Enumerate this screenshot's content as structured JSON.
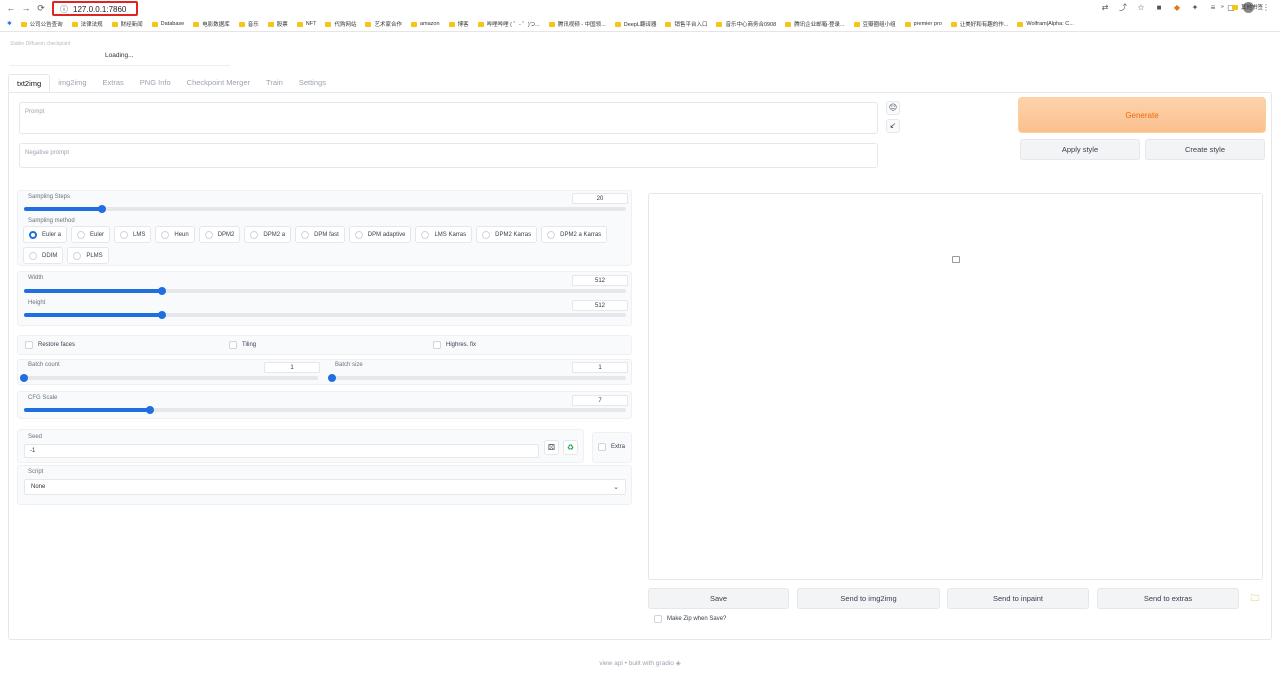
{
  "browser": {
    "url": "127.0.0.1:7860",
    "bookmarks": [
      "公司公告查询",
      "法律法规",
      "财经新闻",
      "Database",
      "电影数据库",
      "音乐",
      "股票",
      "NFT",
      "代购网站",
      "艺术家合作",
      "amazon",
      "博客",
      "哔哩哔哩 ( ゜- ゜)つ...",
      "腾讯视频 - 中国领...",
      "DeepL翻译器",
      "销售平台入口",
      "音乐中心商务合0908",
      "腾讯企业邮箱-登录...",
      "豆瓣圈组小组",
      "premier pro",
      "让美好和有趣的作...",
      "Wolfram|Alpha: C..."
    ],
    "other_bookmarks": "其他书签"
  },
  "app": {
    "loading_ghost": "Stable Diffusion checkpoint",
    "loading": "Loading..."
  },
  "tabs": [
    "txt2img",
    "img2img",
    "Extras",
    "PNG Info",
    "Checkpoint Merger",
    "Train",
    "Settings"
  ],
  "prompt": {
    "placeholder": "Prompt",
    "negative_placeholder": "Negative prompt"
  },
  "buttons": {
    "generate": "Generate",
    "apply_style": "Apply style",
    "create_style": "Create style"
  },
  "sampling": {
    "steps_label": "Sampling Steps",
    "steps_value": "20",
    "steps_fraction": 0.13,
    "method_label": "Sampling method",
    "methods": [
      "Euler a",
      "Euler",
      "LMS",
      "Heun",
      "DPM2",
      "DPM2 a",
      "DPM fast",
      "DPM adaptive",
      "LMS Karras",
      "DPM2 Karras",
      "DPM2 a Karras",
      "DDIM",
      "PLMS"
    ],
    "selected": "Euler a"
  },
  "size": {
    "width_label": "Width",
    "width_value": "512",
    "width_fraction": 0.23,
    "height_label": "Height",
    "height_value": "512",
    "height_fraction": 0.23
  },
  "options": {
    "restore_faces": "Restore faces",
    "tiling": "Tiling",
    "highres": "Highres. fix"
  },
  "batch": {
    "count_label": "Batch count",
    "count_value": "1",
    "count_fraction": 0.0,
    "size_label": "Batch size",
    "size_value": "1",
    "size_fraction": 0.0
  },
  "cfg": {
    "label": "CFG Scale",
    "value": "7",
    "fraction": 0.21
  },
  "seed": {
    "label": "Seed",
    "value": "-1",
    "extra": "Extra"
  },
  "script": {
    "label": "Script",
    "value": "None"
  },
  "output": {
    "save": "Save",
    "send_img2img": "Send to img2img",
    "send_inpaint": "Send to inpaint",
    "send_extras": "Send to extras",
    "make_zip": "Make Zip when Save?"
  },
  "footer": {
    "api": "view api",
    "sep": "•",
    "built": "built with gradio"
  }
}
